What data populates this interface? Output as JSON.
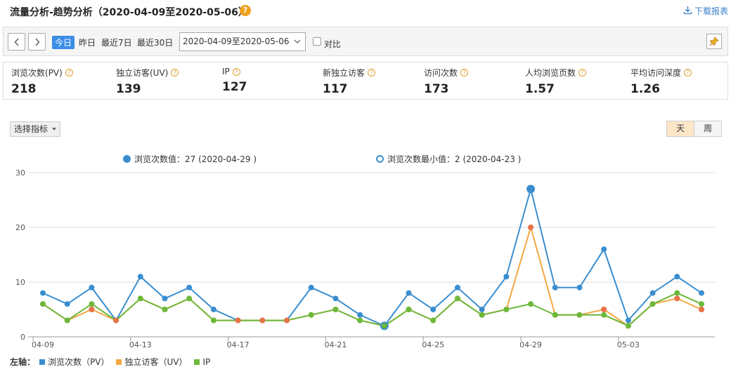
{
  "header": {
    "title": "流量分析-趋势分析（2020-04-09至2020-05-06）",
    "help": "?",
    "download_label": "下载报表"
  },
  "toolbar": {
    "prev": "‹",
    "next": "›",
    "today": "今日",
    "yesterday": "昨日",
    "last7": "最近7日",
    "last30": "最近30日",
    "date_range": "2020-04-09至2020-05-06",
    "compare_label": "对比"
  },
  "metrics": [
    {
      "label": "浏览次数(PV)",
      "value": "218"
    },
    {
      "label": "独立访客(UV)",
      "value": "139"
    },
    {
      "label": "IP",
      "value": "127"
    },
    {
      "label": "新独立访客",
      "value": "117"
    },
    {
      "label": "访问次数",
      "value": "173"
    },
    {
      "label": "人均浏览页数",
      "value": "1.57"
    },
    {
      "label": "平均访问深度",
      "value": "1.26"
    }
  ],
  "controls": {
    "select_metric": "选择指标",
    "day": "天",
    "week": "周"
  },
  "chart_notes": {
    "max_label": "浏览次数值：27 (2020-04-29 )",
    "min_label": "浏览次数最小值：2 (2020-04-23 )"
  },
  "legend": {
    "axis_label": "左轴：",
    "items": [
      {
        "label": "浏览次数（PV）",
        "color": "#3a8ed0"
      },
      {
        "label": "独立访客（UV）",
        "color": "#f5a742"
      },
      {
        "label": "IP",
        "color": "#6cb83a"
      }
    ]
  },
  "chart_data": {
    "type": "line",
    "x": [
      "04-09",
      "04-10",
      "04-11",
      "04-12",
      "04-13",
      "04-14",
      "04-15",
      "04-16",
      "04-17",
      "04-18",
      "04-19",
      "04-20",
      "04-21",
      "04-22",
      "04-23",
      "04-24",
      "04-25",
      "04-26",
      "04-27",
      "04-28",
      "04-29",
      "04-30",
      "05-01",
      "05-02",
      "05-03",
      "05-04",
      "05-05",
      "05-06"
    ],
    "x_tick_labels": [
      "04-09",
      "04-13",
      "04-17",
      "04-21",
      "04-25",
      "04-29",
      "05-03"
    ],
    "ylim": [
      0,
      30
    ],
    "y_ticks": [
      0,
      10,
      20,
      30
    ],
    "grid": true,
    "series": [
      {
        "name": "浏览次数（PV）",
        "color": "#3a8ed0",
        "values": [
          8,
          6,
          9,
          3,
          11,
          7,
          9,
          5,
          3,
          3,
          3,
          9,
          7,
          4,
          2,
          8,
          5,
          9,
          5,
          11,
          27,
          9,
          9,
          16,
          3,
          8,
          11,
          8
        ]
      },
      {
        "name": "独立访客（UV）",
        "color": "#f5a742",
        "values": [
          6,
          3,
          5,
          3,
          7,
          5,
          7,
          3,
          3,
          3,
          3,
          4,
          5,
          3,
          2,
          5,
          3,
          7,
          4,
          5,
          20,
          4,
          4,
          5,
          2,
          6,
          7,
          5
        ]
      },
      {
        "name": "IP",
        "color": "#6cb83a",
        "values": [
          6,
          3,
          6,
          3,
          7,
          5,
          7,
          3,
          3,
          3,
          3,
          4,
          5,
          3,
          2,
          5,
          3,
          7,
          4,
          5,
          6,
          4,
          4,
          4,
          2,
          6,
          8,
          6
        ]
      }
    ],
    "max_point": {
      "series": 0,
      "index": 20
    },
    "min_point": {
      "series": 0,
      "index": 14
    }
  }
}
